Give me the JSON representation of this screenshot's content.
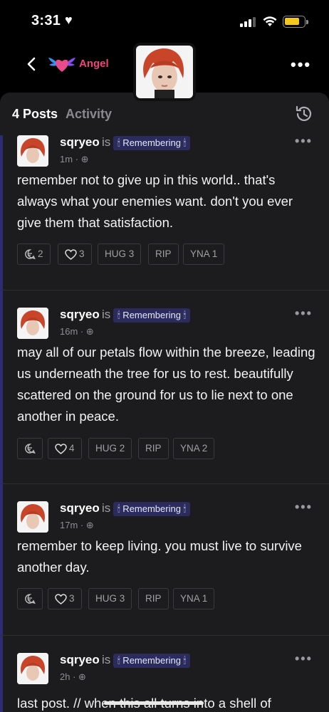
{
  "status_bar": {
    "time": "3:31",
    "heart": "♥"
  },
  "header": {
    "app_name": "Angel",
    "more": "•••"
  },
  "tabs": {
    "posts": "4 Posts",
    "activity": "Activity"
  },
  "posts": [
    {
      "username": "sqryeo",
      "is": "is",
      "badge": "🕯 Remembering 🕯",
      "time": "1m · ⊕",
      "text": "remember not to give up in this world.. that's always what your enemies want. don't you ever give them that satisfaction.",
      "comments": "2",
      "likes": "3",
      "hug_label": "HUG",
      "hug": "3",
      "rip_label": "RIP",
      "rip": "",
      "yna_label": "YNA",
      "yna": "1"
    },
    {
      "username": "sqryeo",
      "is": "is",
      "badge": "🕯 Remembering 🕯",
      "time": "16m · ⊕",
      "text": "may all of our petals flow within the breeze, leading us underneath the tree for us to rest. beautifully scattered on the ground for us to lie next to one another in peace.",
      "comments": "",
      "likes": "4",
      "hug_label": "HUG",
      "hug": "2",
      "rip_label": "RIP",
      "rip": "",
      "yna_label": "YNA",
      "yna": "2"
    },
    {
      "username": "sqryeo",
      "is": "is",
      "badge": "🕯 Remembering 🕯",
      "time": "17m · ⊕",
      "text": "remember to keep living. you must live to survive another day.",
      "comments": "",
      "likes": "3",
      "hug_label": "HUG",
      "hug": "3",
      "rip_label": "RIP",
      "rip": "",
      "yna_label": "YNA",
      "yna": "1"
    },
    {
      "username": "sqryeo",
      "is": "is",
      "badge": "🕯 Remembering 🕯",
      "time": "2h · ⊕",
      "text": "last post. // when this all turns into a shell of"
    }
  ],
  "colors": {
    "accent_bar": "#2c2c72",
    "badge_bg": "#2b2b5e",
    "brand_pink": "#f0417f",
    "battery": "#f4c81a"
  }
}
